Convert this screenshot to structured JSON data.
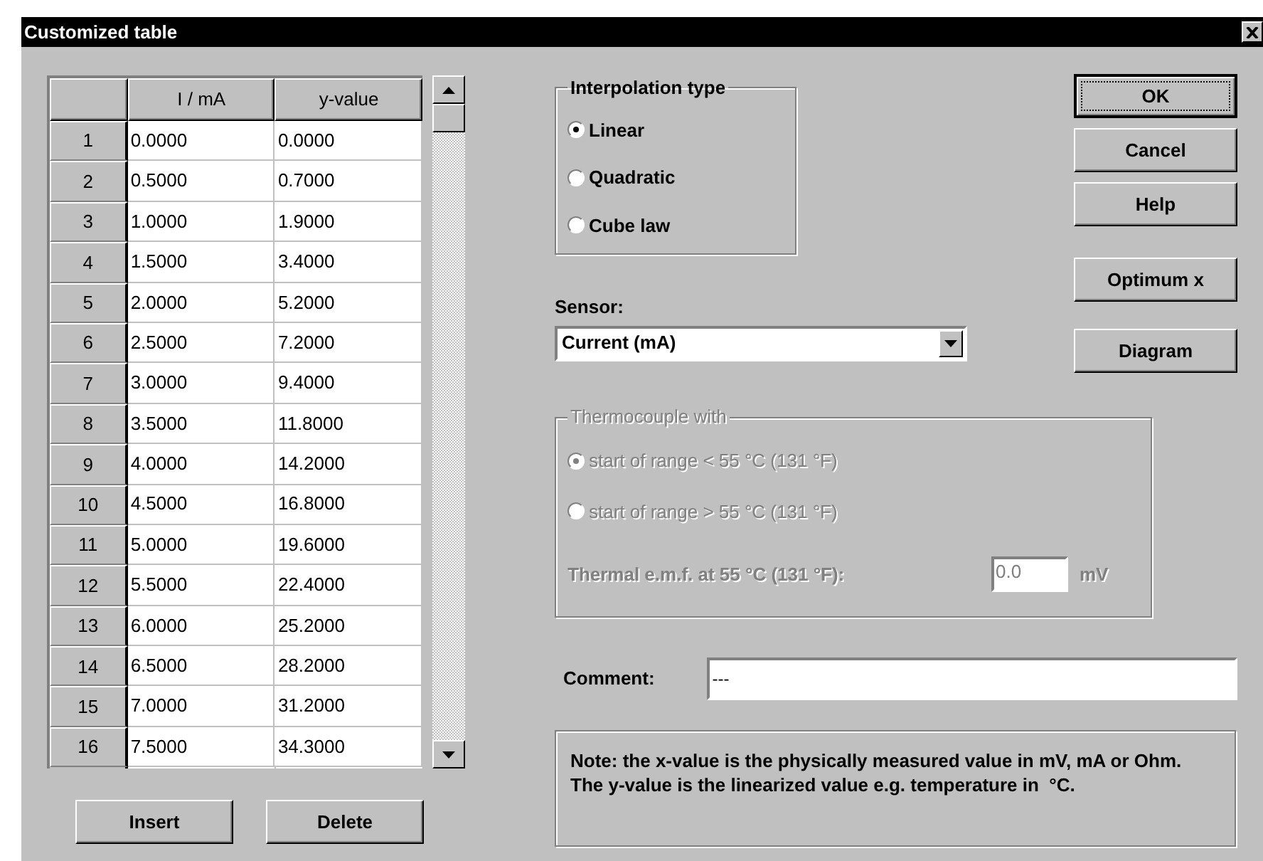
{
  "window": {
    "title": "Customized table"
  },
  "table": {
    "columns": [
      "I / mA",
      "y-value"
    ],
    "rows": [
      {
        "label": "1",
        "cells": [
          "0.0000",
          "0.0000"
        ]
      },
      {
        "label": "2",
        "cells": [
          "0.5000",
          "0.7000"
        ]
      },
      {
        "label": "3",
        "cells": [
          "1.0000",
          "1.9000"
        ]
      },
      {
        "label": "4",
        "cells": [
          "1.5000",
          "3.4000"
        ]
      },
      {
        "label": "5",
        "cells": [
          "2.0000",
          "5.2000"
        ]
      },
      {
        "label": "6",
        "cells": [
          "2.5000",
          "7.2000"
        ]
      },
      {
        "label": "7",
        "cells": [
          "3.0000",
          "9.4000"
        ]
      },
      {
        "label": "8",
        "cells": [
          "3.5000",
          "11.8000"
        ]
      },
      {
        "label": "9",
        "cells": [
          "4.0000",
          "14.2000"
        ]
      },
      {
        "label": "10",
        "cells": [
          "4.5000",
          "16.8000"
        ]
      },
      {
        "label": "11",
        "cells": [
          "5.0000",
          "19.6000"
        ]
      },
      {
        "label": "12",
        "cells": [
          "5.5000",
          "22.4000"
        ]
      },
      {
        "label": "13",
        "cells": [
          "6.0000",
          "25.2000"
        ]
      },
      {
        "label": "14",
        "cells": [
          "6.5000",
          "28.2000"
        ]
      },
      {
        "label": "15",
        "cells": [
          "7.0000",
          "31.2000"
        ]
      },
      {
        "label": "16",
        "cells": [
          "7.5000",
          "34.3000"
        ]
      }
    ]
  },
  "table_buttons": [
    "Insert",
    "Delete"
  ],
  "interpolation": {
    "title": "Interpolation type",
    "options": [
      {
        "label": "Linear",
        "selected": true
      },
      {
        "label": "Quadratic",
        "selected": false
      },
      {
        "label": "Cube law",
        "selected": false
      }
    ]
  },
  "sensor": {
    "label": "Sensor:",
    "value": "Current (mA)"
  },
  "thermocouple": {
    "title": "Thermocouple with",
    "disabled": true,
    "options": [
      {
        "label": "start of range < 55 °C (131 °F)",
        "selected": true
      },
      {
        "label": "start of range > 55 °C (131 °F)",
        "selected": false
      }
    ],
    "emf_label": "Thermal e.m.f. at 55 °C (131 °F):",
    "emf_value": "0.0",
    "emf_unit": "mV"
  },
  "comment": {
    "label": "Comment:",
    "value": "---"
  },
  "note": "Note: the x-value is the physically measured value in mV, mA or Ohm. The y-value is the linearized value e.g. temperature in  °C.",
  "buttons": [
    {
      "label": "OK",
      "default": true
    },
    {
      "label": "Cancel",
      "default": false
    },
    {
      "label": "Help",
      "default": false
    },
    {
      "label": "Optimum x",
      "default": false
    },
    {
      "label": "Diagram",
      "default": false
    }
  ]
}
